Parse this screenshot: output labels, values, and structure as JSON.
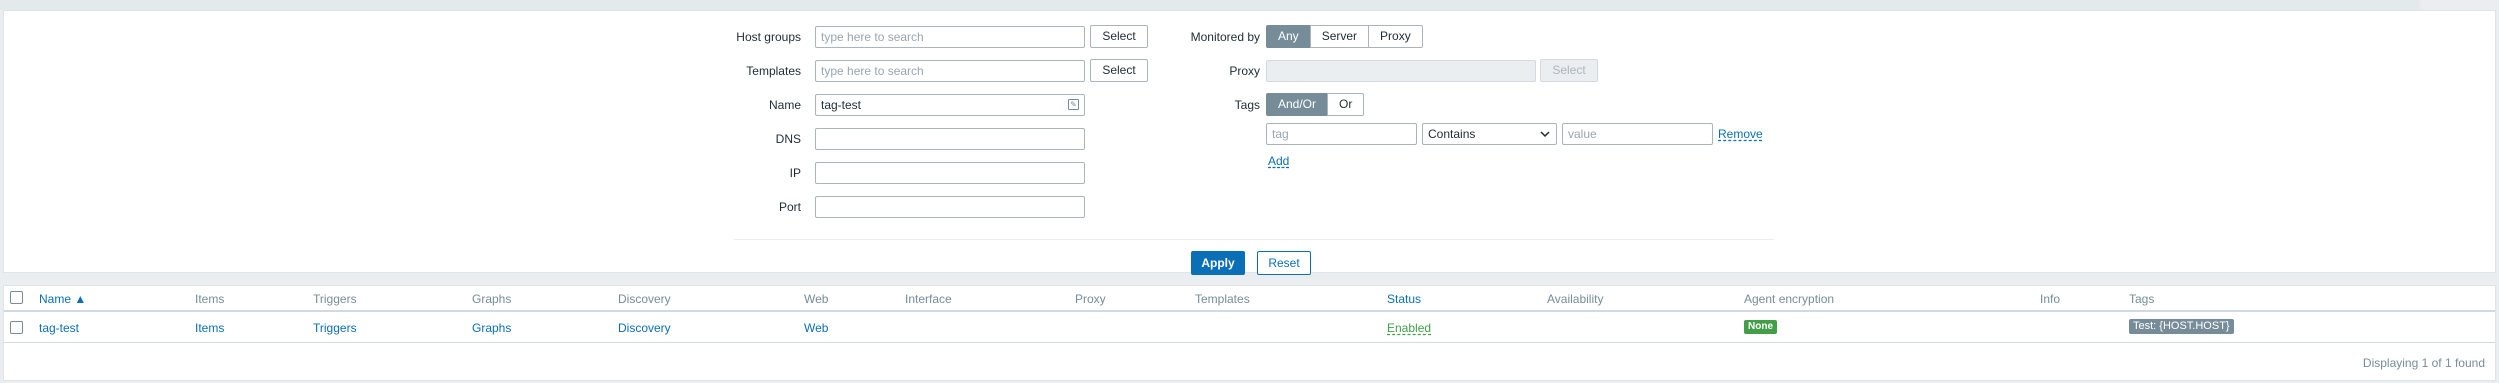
{
  "filter": {
    "host_groups": {
      "label": "Host groups",
      "placeholder": "type here to search",
      "select_label": "Select"
    },
    "templates": {
      "label": "Templates",
      "placeholder": "type here to search",
      "select_label": "Select"
    },
    "name": {
      "label": "Name",
      "value": "tag-test"
    },
    "dns": {
      "label": "DNS",
      "value": ""
    },
    "ip": {
      "label": "IP",
      "value": ""
    },
    "port": {
      "label": "Port",
      "value": ""
    },
    "monitored_by": {
      "label": "Monitored by",
      "options": [
        "Any",
        "Server",
        "Proxy"
      ],
      "selected": "Any"
    },
    "proxy": {
      "label": "Proxy",
      "value": "",
      "select_label": "Select"
    },
    "tags": {
      "label": "Tags",
      "mode_options": [
        "And/Or",
        "Or"
      ],
      "mode_selected": "And/Or",
      "row": {
        "tag_placeholder": "tag",
        "operator": "Contains",
        "value_placeholder": "value",
        "remove_label": "Remove"
      },
      "add_label": "Add"
    },
    "apply_label": "Apply",
    "reset_label": "Reset"
  },
  "table": {
    "columns": [
      "Name ▲",
      "Items",
      "Triggers",
      "Graphs",
      "Discovery",
      "Web",
      "Interface",
      "Proxy",
      "Templates",
      "Status",
      "Availability",
      "Agent encryption",
      "Info",
      "Tags"
    ],
    "rows": [
      {
        "name": "tag-test",
        "items": "Items",
        "triggers": "Triggers",
        "graphs": "Graphs",
        "discovery": "Discovery",
        "web": "Web",
        "interface": "",
        "proxy": "",
        "templates": "",
        "status": "Enabled",
        "availability": "",
        "encryption": "None",
        "info": "",
        "tags": "Test: {HOST.HOST}"
      }
    ],
    "footer": "Displaying 1 of 1 found"
  },
  "colors": {
    "primary": "#0a6fb7",
    "enabled": "#429e47",
    "muted": "#768d99"
  }
}
